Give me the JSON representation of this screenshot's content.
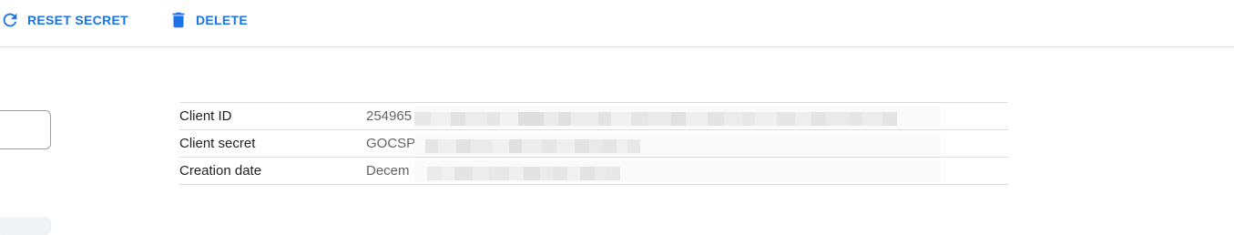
{
  "toolbar": {
    "reset_label": "RESET SECRET",
    "delete_label": "DELETE",
    "reset_icon": "refresh-icon",
    "delete_icon": "trash-icon",
    "accent": "#1a73e8"
  },
  "details": {
    "rows": [
      {
        "label": "Client ID",
        "value": "254965"
      },
      {
        "label": "Client secret",
        "value": "GOCSP"
      },
      {
        "label": "Creation date",
        "value": "Decem"
      }
    ]
  }
}
